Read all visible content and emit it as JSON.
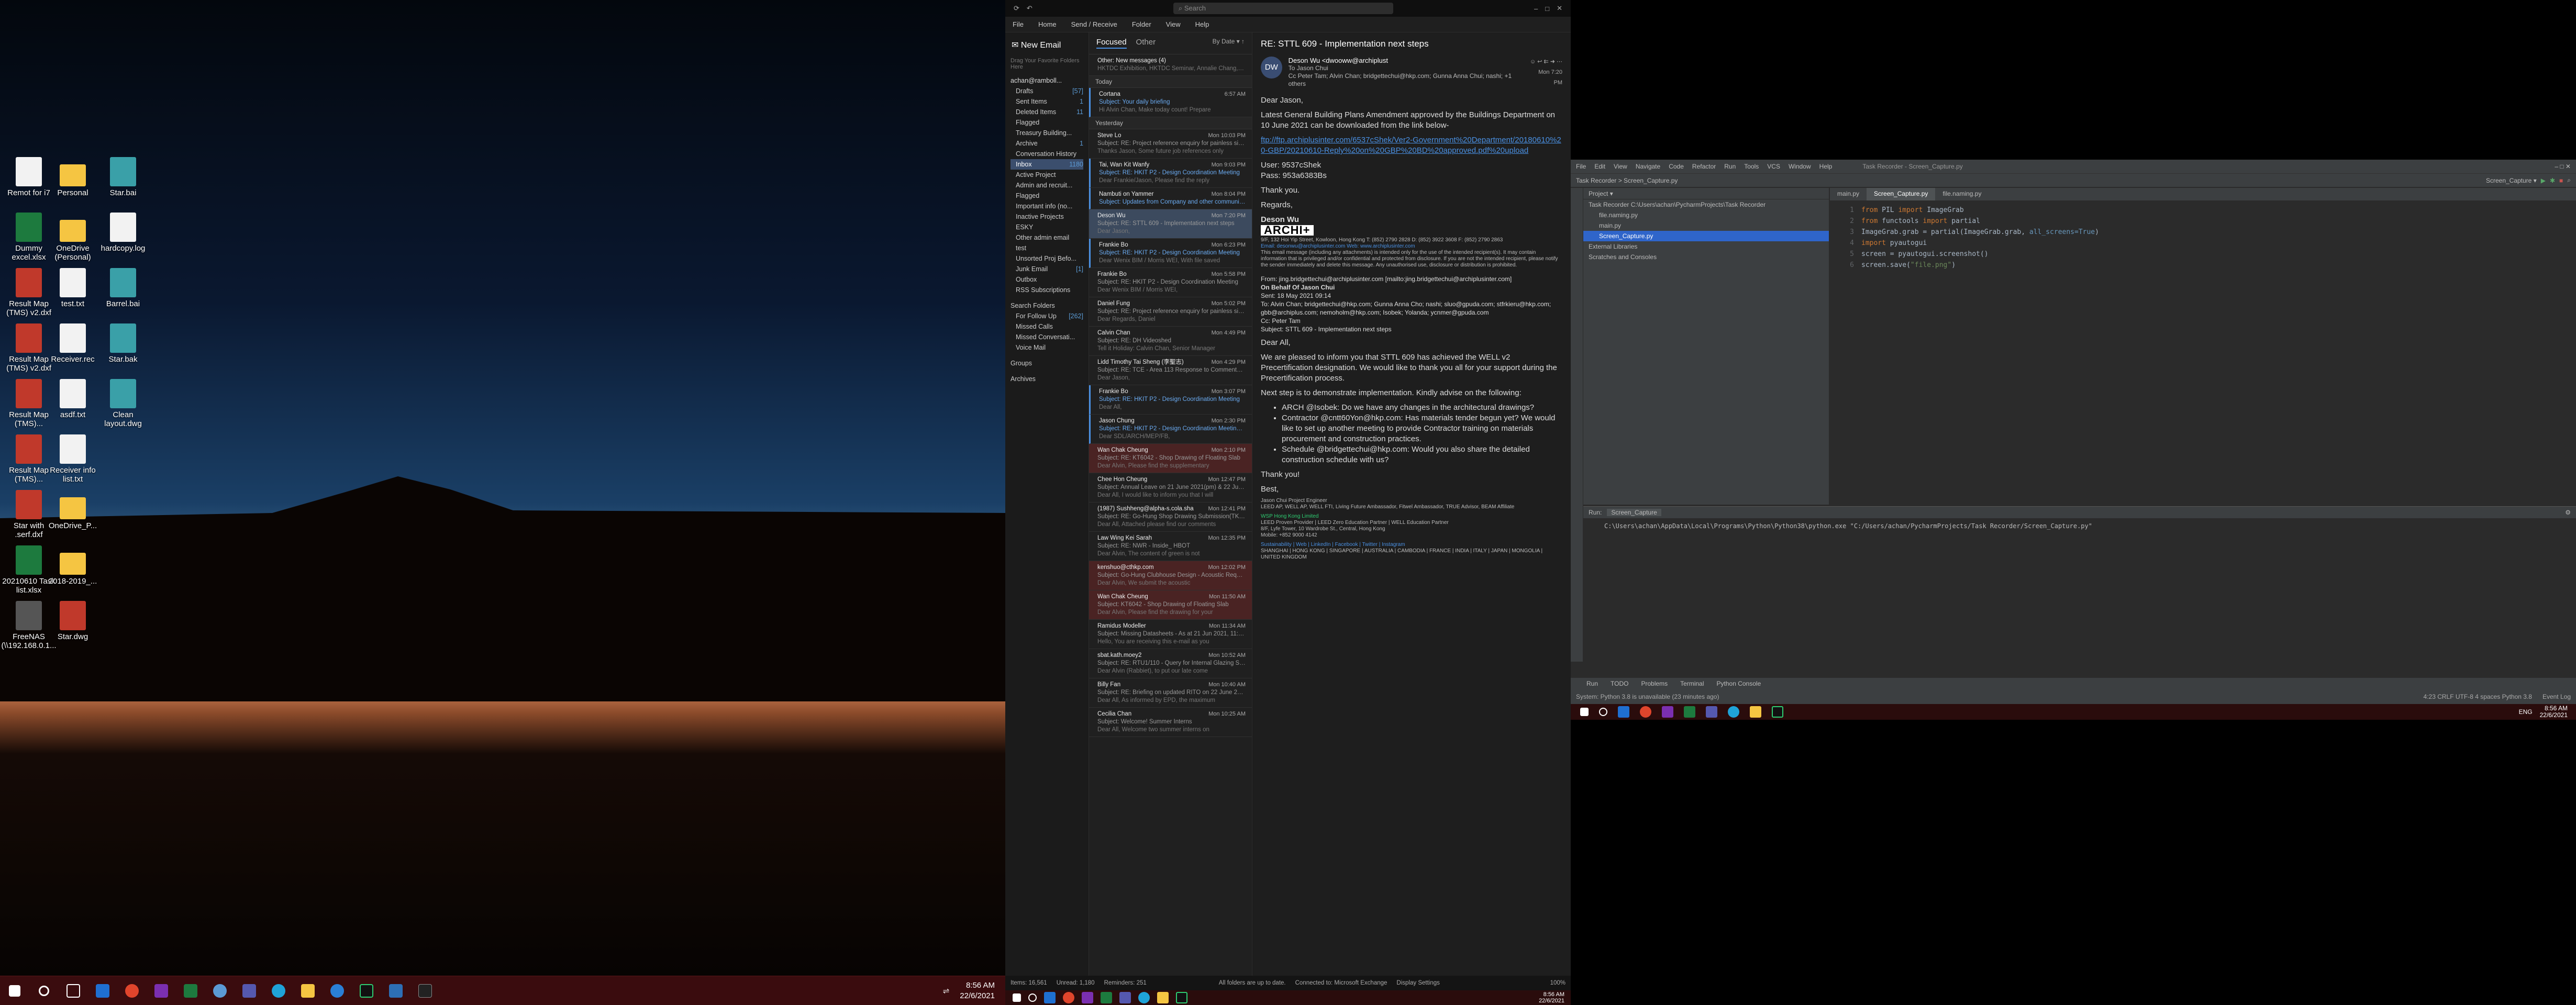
{
  "colors": {
    "taskbar": "#3a0c0e",
    "accent": "#4a90e2",
    "selection": "#3b4e6d",
    "flagged": "#4a2323",
    "ide_bg": "#2b2b2b"
  },
  "desktop": {
    "icons": [
      {
        "label": "Remot for i7",
        "icon": "document-icon",
        "color": "#f2f2f2"
      },
      {
        "label": "Personal",
        "icon": "folder-icon",
        "color": "#f5c542"
      },
      {
        "label": "Star.bai",
        "icon": "cad-icon",
        "color": "#3aa0a8"
      },
      {
        "label": "Dummy excel.xlsx",
        "icon": "excel-icon",
        "color": "#1d7a3e"
      },
      {
        "label": "OneDrive (Personal)",
        "icon": "folder-icon",
        "color": "#f5c542"
      },
      {
        "label": "hardcopy.log",
        "icon": "document-icon",
        "color": "#f2f2f2"
      },
      {
        "label": "Result Map (TMS) v2.dxf",
        "icon": "cad-icon",
        "color": "#c0392b"
      },
      {
        "label": "test.txt",
        "icon": "text-file-icon",
        "color": "#f2f2f2"
      },
      {
        "label": "Barrel.bai",
        "icon": "cad-icon",
        "color": "#3aa0a8"
      },
      {
        "label": "Result Map (TMS) v2.dxf",
        "icon": "cad-icon",
        "color": "#c0392b"
      },
      {
        "label": "Receiver.rec",
        "icon": "document-icon",
        "color": "#f2f2f2"
      },
      {
        "label": "Star.bak",
        "icon": "cad-icon",
        "color": "#3aa0a8"
      },
      {
        "label": "Result Map (TMS)...",
        "icon": "cad-icon",
        "color": "#c0392b"
      },
      {
        "label": "asdf.txt",
        "icon": "text-file-icon",
        "color": "#f2f2f2"
      },
      {
        "label": "Clean layout.dwg",
        "icon": "cad-icon",
        "color": "#3aa0a8"
      },
      {
        "label": "Result Map (TMS)...",
        "icon": "cad-icon",
        "color": "#c0392b"
      },
      {
        "label": "Receiver info list.txt",
        "icon": "text-file-icon",
        "color": "#f2f2f2"
      },
      {
        "label": "Star with .serf.dxf",
        "icon": "cad-icon",
        "color": "#c0392b"
      },
      {
        "label": "OneDrive_P...",
        "icon": "folder-icon",
        "color": "#f5c542"
      },
      {
        "label": "20210610 Task list.xlsx",
        "icon": "excel-icon",
        "color": "#1d7a3e"
      },
      {
        "label": "2018-2019_...",
        "icon": "folder-icon",
        "color": "#f5c542"
      },
      {
        "label": "FreeNAS (\\\\192.168.0.1...",
        "icon": "network-drive-icon",
        "color": "#555"
      },
      {
        "label": "Star.dwg",
        "icon": "cad-icon",
        "color": "#c0392b"
      }
    ],
    "clock": {
      "time": "8:56 AM",
      "date": "22/6/2021"
    }
  },
  "outlook": {
    "search": "Search",
    "menu": [
      "File",
      "Home",
      "Send / Receive",
      "Folder",
      "View",
      "Help"
    ],
    "new_email": "New Email",
    "folder_hint": "Drag Your Favorite Folders Here",
    "account": "achan@ramboll...",
    "folders": [
      {
        "label": "Drafts",
        "count": "[57]"
      },
      {
        "label": "Sent Items",
        "count": "1"
      },
      {
        "label": "Deleted Items",
        "count": "11"
      },
      {
        "label": "Flagged",
        "count": ""
      },
      {
        "label": "Treasury Building...",
        "count": ""
      },
      {
        "label": "Archive",
        "count": "1"
      },
      {
        "label": "Conversation History",
        "count": ""
      },
      {
        "label": "Inbox",
        "count": "1180"
      },
      {
        "label": "Active Project",
        "count": ""
      },
      {
        "label": "Admin and recruit...",
        "count": ""
      },
      {
        "label": "Flagged",
        "count": ""
      },
      {
        "label": "Important info (no...",
        "count": ""
      },
      {
        "label": "Inactive Projects",
        "count": ""
      },
      {
        "label": "ESKY",
        "count": ""
      },
      {
        "label": "Other admin email",
        "count": ""
      },
      {
        "label": "test",
        "count": ""
      },
      {
        "label": "Unsorted Proj Befo...",
        "count": ""
      },
      {
        "label": "Junk Email",
        "count": "[1]"
      },
      {
        "label": "Outbox",
        "count": ""
      },
      {
        "label": "RSS Subscriptions",
        "count": ""
      },
      {
        "label": "Search Folders",
        "count": ""
      },
      {
        "label": "For Follow Up",
        "count": "[262]"
      },
      {
        "label": "Missed Calls",
        "count": ""
      },
      {
        "label": "Missed Conversati...",
        "count": ""
      },
      {
        "label": "Voice Mail",
        "count": ""
      },
      {
        "label": "Groups",
        "count": ""
      },
      {
        "label": "Archives",
        "count": ""
      }
    ],
    "tabs": {
      "focused": "Focused",
      "other": "Other",
      "sort": "By Date"
    },
    "other_note": "Other: New messages (4)",
    "other_preview": "HKTDC Exhibition, HKTDC Seminar, Annalie Chang, Sketchup",
    "groups": {
      "today": "Today",
      "yesterday": "Yesterday"
    },
    "messages": [
      {
        "from": "Cortana",
        "subject": "Subject: Your daily briefing",
        "preview": "Hi Alvin Chan, Make today count! Prepare",
        "date": "6:57 AM",
        "state": "unread"
      },
      {
        "from": "Steve Lo",
        "subject": "Subject: RE: Project reference enquiry for painless silencer",
        "preview": "Thanks Jason, Some future job references only",
        "date": "Mon 10:03 PM",
        "state": ""
      },
      {
        "from": "Tai, Wan Kit Wanfy",
        "subject": "Subject: RE: HKIT P2 - Design Coordination Meeting",
        "preview": "Dear Frankie/Jason, Please find the reply",
        "date": "Mon 9:03 PM",
        "state": "unread"
      },
      {
        "from": "Nambuti on Yammer",
        "subject": "Subject: Updates from Company and other communities",
        "preview": "",
        "date": "Mon 8:04 PM",
        "state": "unread"
      },
      {
        "from": "Deson Wu",
        "subject": "Subject: RE: STTL 609 - Implementation next steps",
        "preview": "Dear Jason,",
        "date": "Mon 7:20 PM",
        "state": "sel"
      },
      {
        "from": "Frankie Bo",
        "subject": "Subject: RE: HKIT P2 - Design Coordination Meeting",
        "preview": "Dear Wenix BIM / Morris WEI, With file saved",
        "date": "Mon 6:23 PM",
        "state": "unread"
      },
      {
        "from": "Frankie Bo",
        "subject": "Subject: RE: HKIT P2 - Design Coordination Meeting",
        "preview": "Dear Wenix BIM / Morris WEI,",
        "date": "Mon 5:58 PM",
        "state": ""
      },
      {
        "from": "Daniel Fung",
        "subject": "Subject: RE: Project reference enquiry for painless silencer",
        "preview": "Dear Regards, Daniel",
        "date": "Mon 5:02 PM",
        "state": ""
      },
      {
        "from": "Calvin Chan",
        "subject": "Subject: RE: DH Videoshed",
        "preview": "Tell it Holiday: Calvin Chan, Senior Manager",
        "date": "Mon 4:49 PM",
        "state": ""
      },
      {
        "from": "Lidd Timothy Tai Sheng (李聖志)",
        "subject": "Subject: RE: TCE - Area 113 Response to Comments Require...",
        "preview": "Dear Jason,",
        "date": "Mon 4:29 PM",
        "state": ""
      },
      {
        "from": "Frankie Bo",
        "subject": "Subject: RE: HKIT P2 - Design Coordination Meeting",
        "preview": "Dear All,",
        "date": "Mon 3:07 PM",
        "state": "unread"
      },
      {
        "from": "Jason Chung",
        "subject": "Subject: RE: HKIT P2 - Design Coordination Meeting - Tender a...",
        "preview": "Dear SDL/ARCH/MEP/FB,",
        "date": "Mon 2:30 PM",
        "state": "unread"
      },
      {
        "from": "Wan Chak Cheung",
        "subject": "Subject: RE: KT6042 - Shop Drawing of Floating Slab",
        "preview": "Dear Alvin, Please find the supplementary",
        "date": "Mon 2:10 PM",
        "state": "flag"
      },
      {
        "from": "Chee Hon Cheung",
        "subject": "Subject: Annual Leave on 21 June 2021(pm) & 22 June 2021",
        "preview": "Dear All, I would like to inform you that I will",
        "date": "Mon 12:47 PM",
        "state": ""
      },
      {
        "from": "(1987) Sushheng@alpha-s.cola.sha",
        "subject": "Subject: RE: Go-Hung Shop Drawing Submission(TKP0402...",
        "preview": "Dear All, Attached please find our comments",
        "date": "Mon 12:41 PM",
        "state": ""
      },
      {
        "from": "Law Wing Kei Sarah",
        "subject": "Subject: RE: NWR - Inside_ HBOT",
        "preview": "Dear Alvin, The content of green is not",
        "date": "Mon 12:35 PM",
        "state": ""
      },
      {
        "from": "kenshuo@cthkp.com",
        "subject": "Subject: Go-Hung Clubhouse Design - Acoustic Requireme...",
        "preview": "Dear Alvin, We submit the acoustic",
        "date": "Mon 12:02 PM",
        "state": "flag"
      },
      {
        "from": "Wan Chak Cheung",
        "subject": "Subject: KT6042 - Shop Drawing of Floating Slab",
        "preview": "Dear Alvin, Please find the drawing for your",
        "date": "Mon 11:50 AM",
        "state": "flag"
      },
      {
        "from": "Ramidus Modeller",
        "subject": "Subject: Missing Datasheets - As at 21 Jun 2021, 11:35 (An...",
        "preview": "Hello, You are receiving this e-mail as you",
        "date": "Mon 11:34 AM",
        "state": ""
      },
      {
        "from": "sbat.kath.moey2",
        "subject": "Subject: RE: RTU1/110 - Query for Internal Glazing STC Req...",
        "preview": "Dear Alvin (Rabbiet), to put our late come",
        "date": "Mon 10:52 AM",
        "state": ""
      },
      {
        "from": "Billy Fan",
        "subject": "Subject: RE: Briefing on updated RITO on 22 June 2021 ...",
        "preview": "Dear All, As informed by EPD, the maximum",
        "date": "Mon 10:40 AM",
        "state": ""
      },
      {
        "from": "Cecilia Chan",
        "subject": "Subject: Welcome! Summer Interns",
        "preview": "Dear All, Welcome two summer interns on",
        "date": "Mon 10:25 AM",
        "state": ""
      }
    ],
    "reading": {
      "subject": "RE: STTL 609 - Implementation next steps",
      "from": "Deson Wu <dwooww@archiplust",
      "to": "Jason Chui",
      "cc": "Peter Tam; Alvin Chan; bridgettechui@hkp.com; Gunna Anna Chui; nashi; +1 others",
      "time": "Mon 7:20 PM",
      "initials": "DW",
      "greeting": "Dear Jason,",
      "para1": "Latest General Building Plans Amendment approved by the Buildings Department on 10 June 2021 can be downloaded from the link below-",
      "link": "ftp://ftp.archiplusinter.com/6537cShek/Ver2-Government%20Department/20180610%20-GBP/20210610-Reply%20on%20GBP%20BD%20approved.pdf%20upload",
      "user": "User: 9537cShek",
      "pass": "Pass: 953a6383Bs",
      "thanks": "Thank you.",
      "regards": "Regards,",
      "sig_name": "Deson Wu",
      "logo": "ARCHI+",
      "addr": "9/F, 132 Hoi Yip Street, Kowloon, Hong Kong  T: (852) 2790 2828  D: (852) 3922 3608  F: (852) 2790 2863",
      "email_line": "Email: desonwu@archiplusinter.com   Web: www.archiplusinter.com",
      "disclaimer": "This email message (including any attachments) is intended only for the use of the intended recipient(s). It may contain information that is privileged and/or confidential and protected from disclosure. If you are not the intended recipient, please notify the sender immediately and delete this message. Any unauthorised use, disclosure or distribution is prohibited.",
      "q_from": "From: jing.bridgettechui@archiplusinter.com [mailto:jing.bridgettechui@archiplusinter.com]",
      "q_behalf": "On Behalf Of Jason Chui",
      "q_sent": "Sent: 18 May 2021 09:14",
      "q_to": "To: Alvin Chan; bridgettechui@hkp.com; Gunna Anna Cho; nashi; sluo@gpuda.com; stfrkieru@hkp.com; gbb@archiplus.com; nemoholm@hkp.com; Isobek; Yolanda; ycnmer@gpuda.com",
      "q_cc": "Cc: Peter Tam",
      "q_subj": "Subject: STTL 609 - Implementation next steps",
      "dear_all": "Dear All,",
      "p2": "We are pleased to inform you that STTL 609 has achieved the WELL v2 Precertification designation. We would like to thank you all for your support during the Precertification process.",
      "p3": "Next step is to demonstrate implementation. Kindly advise on the following:",
      "bullets": [
        "ARCH @Isobek: Do we have any changes in the architectural drawings?",
        "Contractor @cntt60Yon@hkp.com: Has materials tender begun yet? We would like to set up another meeting to provide Contractor training on materials procurement and construction practices.",
        "Schedule @bridgettechui@hkp.com: Would you also share the detailed construction schedule with us?"
      ],
      "thanks2": "Thank you!",
      "best": "Best,",
      "sig2": "Jason Chui  Project Engineer",
      "sig2_line": "LEED AP, WELL AP, WELL FTI, Living Future Ambassador, Fitwel Ambassador, TRUE Advisor, BEAM Affiliate",
      "sig2_co": "WSP Hong Kong Limited",
      "sig2_addr": "LEED Proven Provider | LEED Zero Education Partner | WELL Education Partner",
      "sig2_addr2": "8/F, Lyfe Tower, 10 Wardrobe St., Central, Hong Kong",
      "sig2_mob": "Mobile: +852 9000 4142",
      "sig2_links": "Sustainability | Web | LinkedIn | Facebook | Twitter | Instagram",
      "sig2_cities": "SHANGHAI | HONG KONG | SINGAPORE | AUSTRALIA | CAMBODIA | FRANCE | INDIA | ITALY | JAPAN | MONGOLIA | UNITED KINGDOM"
    },
    "status": {
      "items": "Items: 16,561",
      "unread": "Unread: 1,180",
      "reminders": "Reminders: 251",
      "sync": "All folders are up to date.",
      "conn": "Connected to: Microsoft Exchange",
      "display": "Display Settings",
      "zoom": "100%"
    },
    "clock": {
      "time": "8:56 AM",
      "date": "22/6/2021"
    }
  },
  "pycharm": {
    "menu": [
      "File",
      "Edit",
      "View",
      "Navigate",
      "Code",
      "Refactor",
      "Run",
      "Tools",
      "VCS",
      "Window",
      "Help"
    ],
    "window_title": "Task Recorder - Screen_Capture.py",
    "breadcrumb": "Task Recorder  >  Screen_Capture.py",
    "run_config": "Screen_Capture",
    "project_label": "Project",
    "tree": [
      "Task Recorder  C:\\Users\\achan\\PycharmProjects\\Task Recorder",
      "file.naming.py",
      "main.py",
      "Screen_Capture.py",
      "External Libraries",
      "Scratches and Consoles"
    ],
    "tabs": [
      "main.py",
      "Screen_Capture.py",
      "file.naming.py"
    ],
    "code": [
      {
        "n": "1",
        "parts": [
          [
            "kw",
            "from "
          ],
          [
            "fn",
            "PIL "
          ],
          [
            "kw",
            "import "
          ],
          [
            "fn",
            "ImageGrab"
          ]
        ]
      },
      {
        "n": "2",
        "parts": [
          [
            "kw",
            "from "
          ],
          [
            "fn",
            "functools "
          ],
          [
            "kw",
            "import "
          ],
          [
            "fn",
            "partial"
          ]
        ]
      },
      {
        "n": "3",
        "parts": [
          [
            "fn",
            "ImageGrab.grab = partial(ImageGrab.grab, "
          ],
          [
            "num",
            "all_screens=True"
          ],
          [
            "fn",
            ")"
          ]
        ]
      },
      {
        "n": "4",
        "parts": [
          [
            "kw",
            "import "
          ],
          [
            "fn",
            "pyautogui"
          ]
        ]
      },
      {
        "n": "5",
        "parts": [
          [
            "fn",
            "screen = pyautogui.screenshot()"
          ]
        ]
      },
      {
        "n": "6",
        "parts": [
          [
            "fn",
            "screen.save("
          ],
          [
            "str",
            "\"file.png\""
          ],
          [
            "fn",
            ")"
          ]
        ]
      }
    ],
    "run_label": "Run:",
    "run_tab": "Screen_Capture",
    "run_output": "C:\\Users\\achan\\AppData\\Local\\Programs\\Python\\Python38\\python.exe \"C:/Users/achan/PycharmProjects/Task Recorder/Screen_Capture.py\"",
    "bottom_tabs": [
      "Run",
      "TODO",
      "Problems",
      "Terminal",
      "Python Console"
    ],
    "event_log": "Event Log",
    "status": "System: Python 3.8 is unavailable (23 minutes ago)",
    "status_right": "4:23  CRLF  UTF-8  4 spaces  Python 3.8",
    "clock": {
      "time": "8:56 AM",
      "date": "22/6/2021"
    },
    "lang": "ENG"
  }
}
